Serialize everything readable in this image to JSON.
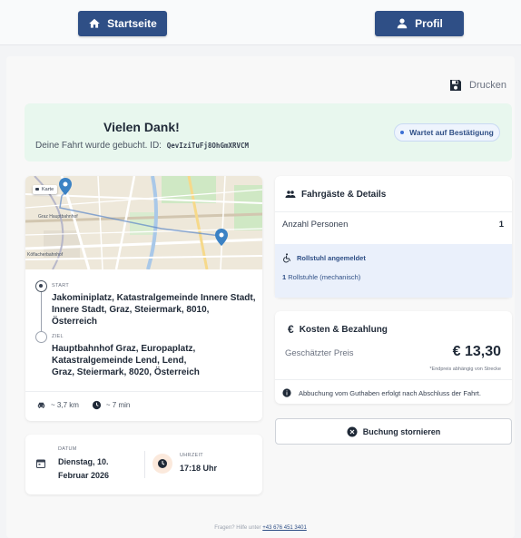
{
  "nav": {
    "home_label": "Startseite",
    "profile_label": "Profil"
  },
  "print_label": "Drucken",
  "confirmation": {
    "title": "Vielen Dank!",
    "subtitle": "Deine Fahrt wurde gebucht. ID:",
    "booking_id": "QevIziTuFj8OhGmXRVCM",
    "status": "Wartet auf Bestätigung"
  },
  "map": {
    "layer_label": "Karte",
    "labels": [
      "Graz Hauptbahnhof",
      "Köflacherbahnhof"
    ]
  },
  "route": {
    "start_tag": "START",
    "start_address": "Jakominiplatz, Katastralgemeinde Innere Stadt, Innere Stadt, Graz, Steiermark, 8010, Österreich",
    "end_tag": "ZIEL",
    "end_address": "Hauptbahnhof Graz, Europaplatz, Katastralgemeinde Lend, Lend, Graz, Steiermark, 8020, Österreich",
    "distance": "~ 3,7 km",
    "duration": "~ 7 min"
  },
  "schedule": {
    "date_tag": "DATUM",
    "date_value": "Dienstag, 10. Februar 2026",
    "time_tag": "UHRZEIT",
    "time_value": "17:18 Uhr"
  },
  "passengers": {
    "title": "Fahrgäste & Details",
    "persons_label": "Anzahl Personen",
    "persons_value": "1",
    "wheelchair_title": "Rollstuhl angemeldet",
    "wheelchair_count": "1",
    "wheelchair_type": "Rollstuhle (mechanisch)"
  },
  "costs": {
    "title": "Kosten & Bezahlung",
    "price_label": "Geschätzter Preis",
    "price_value": "€ 13,30",
    "price_note": "*Endpreis abhängig von Strecke",
    "info": "Abbuchung vom Guthaben erfolgt nach Abschluss der Fahrt."
  },
  "cancel_label": "Buchung stornieren",
  "footer": {
    "text": "Fragen? Hilfe unter",
    "phone": "+43 676 451 3401"
  },
  "colors": {
    "primary": "#2f4f86",
    "success_bg": "#e8f7ee",
    "info_bg": "#eaf0fb",
    "map_pin": "#3b82c4"
  }
}
